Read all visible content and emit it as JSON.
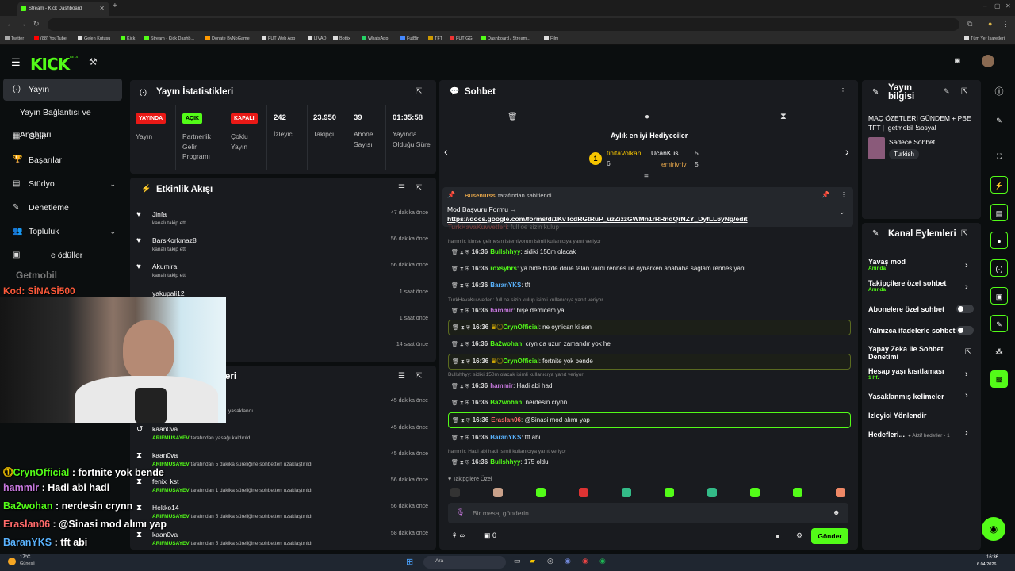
{
  "browser": {
    "tab_title": "Stream - Kick Dashboard",
    "bookmarks": [
      "Twitter",
      "(88) YouTube",
      "Gelen Kutusu",
      "Kick",
      "Stream - Kick Dashb...",
      "Donate ByNoGame",
      "FUT Web App",
      "LIVAD",
      "Botfix",
      "WhatsApp",
      "FutBin",
      "TFT",
      "FUT GG",
      "Dashboard / Stream...",
      "Film"
    ],
    "all_bookmarks": "Tüm Yer İşaretleri"
  },
  "kick": {
    "logo": "KICK",
    "beta": "BETA"
  },
  "sidebar": {
    "items": [
      {
        "label": "Yayın",
        "icon": "(·)"
      },
      {
        "label": "Yayın Bağlantısı ve Anahtarı",
        "icon": ""
      },
      {
        "label": "Gelir",
        "icon": "▦"
      },
      {
        "label": "Başarılar",
        "icon": "🏆"
      },
      {
        "label": "Stüdyo",
        "icon": "▤"
      },
      {
        "label": "Denetleme",
        "icon": "✎"
      },
      {
        "label": "Topluluk",
        "icon": "👥"
      },
      {
        "label": "e ödüller",
        "icon": "▣"
      }
    ]
  },
  "overlay": {
    "watermark": "Getmobil",
    "code_label": "Kod:",
    "code": "SİNASİ500",
    "chat": [
      {
        "user": "CrynOfficial",
        "text": " : fortnite yok bende",
        "color": "#53fc18"
      },
      {
        "user": "hammir",
        "text": " : Hadi abi hadi",
        "color": "#c678dd"
      },
      {
        "user": "Ba2wohan",
        "text": " : nerdesin crynn",
        "color": "#53fc18"
      },
      {
        "user": "Eraslan06",
        "text": " : @Sinasi mod alımı yap",
        "color": "#ff6b6b"
      },
      {
        "user": "BaranYKS",
        "text": " : tft abi",
        "color": "#5ab4ff"
      }
    ]
  },
  "stats": {
    "title": "Yayın İstatistikleri",
    "items": [
      {
        "badge": "YAYINDA",
        "label": "Yayın"
      },
      {
        "badge": "AÇIK",
        "label": "Partnerlik Gelir Programı"
      },
      {
        "badge": "KAPALI",
        "label": "Çoklu Yayın"
      },
      {
        "value": "242",
        "label": "İzleyici"
      },
      {
        "value": "23.950",
        "label": "Takipçi"
      },
      {
        "value": "39",
        "label": "Abone Sayısı"
      },
      {
        "value": "01:35:58",
        "label": "Yayında Olduğu Süre"
      }
    ]
  },
  "activity": {
    "title": "Etkinlik Akışı",
    "items": [
      {
        "name": "Jinfa",
        "sub": "kanalı takip etti",
        "time": "47 dakika önce"
      },
      {
        "name": "BarsKorkmaz8",
        "sub": "kanalı takip etti",
        "time": "56 dakika önce"
      },
      {
        "name": "Akumira",
        "sub": "kanalı takip etti",
        "time": "56 dakika önce"
      },
      {
        "name": "yakupali12",
        "sub": "",
        "time": "1 saat önce"
      },
      {
        "name": "",
        "sub": "",
        "time": "1 saat önce"
      },
      {
        "name": "",
        "sub": "",
        "time": "14 saat önce"
      }
    ]
  },
  "mod_log": {
    "title": "eri",
    "items": [
      {
        "name": "",
        "by": "",
        "sub": "yasaklandı",
        "time": "45 dakika önce"
      },
      {
        "name": "kaan0va",
        "by": "ARIFMUSAYEV",
        "sub": " tarafından yasağı kaldırıldı",
        "time": "45 dakika önce"
      },
      {
        "name": "kaan0va",
        "by": "ARIFMUSAYEV",
        "sub": " tarafından 5 dakika süreliğine sohbetten uzaklaştırıldı",
        "time": "45 dakika önce"
      },
      {
        "name": "fenix_kst",
        "by": "ARIFMUSAYEV",
        "sub": " tarafından 1 dakika süreliğine sohbetten uzaklaştırıldı",
        "time": "56 dakika önce"
      },
      {
        "name": "Hekko14",
        "by": "ARIFMUSAYEV",
        "sub": " tarafından 5 dakika süreliğine sohbetten uzaklaştırıldı",
        "time": "56 dakika önce"
      },
      {
        "name": "kaan0va",
        "by": "ARIFMUSAYEV",
        "sub": " tarafından 5 dakika süreliğine sohbetten uzaklaştırıldı",
        "time": "58 dakika önce"
      }
    ]
  },
  "chat": {
    "title": "Sohbet",
    "gifters_title": "Aylık en iyi Hediyeciler",
    "gifters": [
      {
        "name": "tinitaVolkan",
        "count": "6"
      },
      {
        "name": "UcanKus",
        "count": "5"
      },
      {
        "name": "emirivriv",
        "count": "5"
      }
    ],
    "pinned_by": "Busenurss",
    "pinned_by_suffix": " tarafından sabitlendi",
    "pinned_title": "Mod Başvuru Formu →",
    "pinned_link": "https://docs.google.com/forms/d/1KvTcdRGtRuP_uzZizzGWMn1rRRndQrNZY_DyfLL6yNg/edit",
    "top_partial": "hammir: suet",
    "messages": [
      {
        "time": "",
        "user": "TurkHavaKuvvetleri",
        "text": ": full oe sizin kulup",
        "color": "#ff6b6b",
        "reply": ""
      },
      {
        "time": "16:36",
        "user": "Bullshhyy",
        "text": ": sidiki 150m olacak",
        "color": "#53fc18",
        "reply": "hammir: kimse gelmesin istemiyorum isimli kullanıcıya yanıt veriyor"
      },
      {
        "time": "16:36",
        "user": "roxsybrs",
        "text": ": ya bide bizde doue falan vardı rennes ile oynarken ahahaha sağlam rennes yani",
        "color": "#53fc18",
        "reply": ""
      },
      {
        "time": "16:36",
        "user": "BaranYKS",
        "text": ": tft",
        "color": "#5ab4ff",
        "reply": ""
      },
      {
        "time": "16:36",
        "user": "hammir",
        "text": ": bişe demicem ya",
        "color": "#c678dd",
        "reply": "TurkHavaKuvvetleri: full oe sizin kulup isimli kullanıcıya yanıt veriyor"
      },
      {
        "time": "16:36",
        "user": "CrynOfficial",
        "text": ": ne oynican ki sen",
        "color": "#53fc18",
        "reply": ""
      },
      {
        "time": "16:36",
        "user": "Ba2wohan",
        "text": ": cryn da uzun zamandır yok he",
        "color": "#53fc18",
        "reply": ""
      },
      {
        "time": "16:36",
        "user": "CrynOfficial",
        "text": ": fortnite yok bende",
        "color": "#53fc18",
        "reply": ""
      },
      {
        "time": "16:36",
        "user": "hammir",
        "text": ": Hadi abi hadi",
        "color": "#c678dd",
        "reply": "Bullshhyy: sidiki 150m olacak isimli kullanıcıya yanıt veriyor"
      },
      {
        "time": "16:36",
        "user": "Ba2wohan",
        "text": ": nerdesin crynn",
        "color": "#53fc18",
        "reply": ""
      },
      {
        "time": "16:36",
        "user": "Eraslan06",
        "text": ": @Sinasi mod alımı yap",
        "color": "#ff6b6b",
        "reply": ""
      },
      {
        "time": "16:36",
        "user": "BaranYKS",
        "text": ": tft abi",
        "color": "#5ab4ff",
        "reply": ""
      },
      {
        "time": "16:36",
        "user": "Bullshhyy",
        "text": ": 175 oldu",
        "color": "#53fc18",
        "reply": "hammir: Hadi abi hadi isimli kullanıcıya yanıt veriyor"
      }
    ],
    "emote_section": "Takipçilere Özel",
    "input_placeholder": "Bir mesaj gönderin",
    "points": "∞",
    "count": "0",
    "send": "Gönder"
  },
  "stream_info": {
    "title": "Yayın bilgisi",
    "stream_title": "MAÇ ÖZETLERİ GÜNDEM + PBE TFT | !getmobil !sosyal",
    "category": "Sadece Sohbet",
    "tag": "Turkish"
  },
  "channel_actions": {
    "title": "Kanal Eylemleri",
    "items": [
      {
        "label": "Yavaş mod",
        "sub": "Anında",
        "control": "chevron"
      },
      {
        "label": "Takipçilere özel sohbet",
        "sub": "Anında",
        "control": "chevron"
      },
      {
        "label": "Abonelere özel sohbet",
        "sub": "",
        "control": "toggle"
      },
      {
        "label": "Yalnızca ifadelerle sohbet",
        "sub": "",
        "control": "toggle"
      },
      {
        "label": "Yapay Zeka ile Sohbet Denetimi",
        "sub": "",
        "control": "external"
      },
      {
        "label": "Hesap yaşı kısıtlaması",
        "sub": "1 hf.",
        "control": "chevron"
      },
      {
        "label": "Yasaklanmış kelimeler",
        "sub": "",
        "control": "chevron"
      },
      {
        "label": "İzleyici Yönlendir",
        "sub": "",
        "control": "none"
      },
      {
        "label": "Hedefleri...",
        "sub": "",
        "control": "chevron",
        "extra": "● Aktif hedefler - 1"
      }
    ]
  },
  "taskbar": {
    "weather_temp": "17°C",
    "weather_desc": "Güneşli",
    "search": "Ara",
    "time": "16:36",
    "date": "6.04.2026"
  },
  "colors": {
    "accent": "#53fc18",
    "bg": "#0b0e0f",
    "panel": "#191b1f",
    "live": "#e91916"
  }
}
